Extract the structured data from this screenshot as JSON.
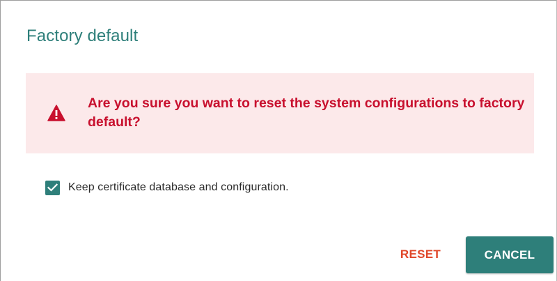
{
  "dialog": {
    "title": "Factory default",
    "alert": {
      "icon": "warning-triangle-icon",
      "message": "Are you sure you want to reset the system configurations to factory default?",
      "text_color": "#c8102e",
      "background": "#fce9ea"
    },
    "checkbox": {
      "label": "Keep certificate database and configuration.",
      "checked": true
    },
    "buttons": {
      "reset_label": "RESET",
      "cancel_label": "CANCEL"
    }
  },
  "colors": {
    "accent": "#2e7f7a",
    "reset_text": "#e0472a"
  }
}
